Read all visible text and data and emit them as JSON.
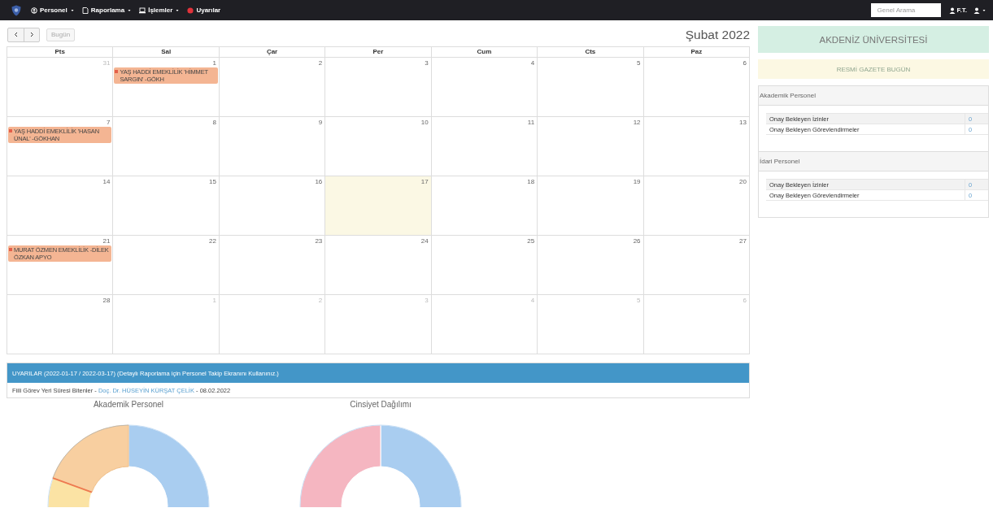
{
  "navbar": {
    "menus": [
      {
        "label": "Personel",
        "kind": "dropdown"
      },
      {
        "label": "Raporlama",
        "kind": "dropdown"
      },
      {
        "label": "İşlemler",
        "kind": "dropdown"
      },
      {
        "label": "Uyarılar",
        "kind": "link"
      }
    ],
    "search": {
      "placeholder": "Genel Arama"
    },
    "user": {
      "label": "F.T."
    }
  },
  "calendar": {
    "title": "Şubat 2022",
    "today_button": {
      "label": "Bugün",
      "disabled": true
    },
    "weekdays": [
      "Pts",
      "Sal",
      "Çar",
      "Per",
      "Cum",
      "Cts",
      "Paz"
    ],
    "weeks": [
      [
        {
          "number": "31",
          "other_month": true,
          "today": false
        },
        {
          "number": "1",
          "other_month": false,
          "today": false,
          "events": [
            {
              "title": "YAŞ HADDİ EMEKLİLİK 'HİMMET SARGIN' -GÖKH",
              "color": "#f4b593"
            }
          ]
        },
        {
          "number": "2",
          "other_month": false,
          "today": false
        },
        {
          "number": "3",
          "other_month": false,
          "today": false
        },
        {
          "number": "4",
          "other_month": false,
          "today": false
        },
        {
          "number": "5",
          "other_month": false,
          "today": false
        },
        {
          "number": "6",
          "other_month": false,
          "today": false
        }
      ],
      [
        {
          "number": "7",
          "other_month": false,
          "today": false,
          "events": [
            {
              "title": "YAŞ HADDİ EMEKLİLİK 'HASAN ÜNAL' -GÖKHAN",
              "color": "#f4b593"
            }
          ]
        },
        {
          "number": "8",
          "other_month": false,
          "today": false
        },
        {
          "number": "9",
          "other_month": false,
          "today": false
        },
        {
          "number": "10",
          "other_month": false,
          "today": false
        },
        {
          "number": "11",
          "other_month": false,
          "today": false
        },
        {
          "number": "12",
          "other_month": false,
          "today": false
        },
        {
          "number": "13",
          "other_month": false,
          "today": false
        }
      ],
      [
        {
          "number": "14",
          "other_month": false,
          "today": false
        },
        {
          "number": "15",
          "other_month": false,
          "today": false
        },
        {
          "number": "16",
          "other_month": false,
          "today": false
        },
        {
          "number": "17",
          "other_month": false,
          "today": true
        },
        {
          "number": "18",
          "other_month": false,
          "today": false
        },
        {
          "number": "19",
          "other_month": false,
          "today": false
        },
        {
          "number": "20",
          "other_month": false,
          "today": false
        }
      ],
      [
        {
          "number": "21",
          "other_month": false,
          "today": false,
          "events": [
            {
              "title": "MURAT ÖZMEN EMEKLİLİK -DİLEK ÖZKAN APYO",
              "color": "#f4b593"
            }
          ]
        },
        {
          "number": "22",
          "other_month": false,
          "today": false
        },
        {
          "number": "23",
          "other_month": false,
          "today": false
        },
        {
          "number": "24",
          "other_month": false,
          "today": false
        },
        {
          "number": "25",
          "other_month": false,
          "today": false
        },
        {
          "number": "26",
          "other_month": false,
          "today": false
        },
        {
          "number": "27",
          "other_month": false,
          "today": false
        }
      ],
      [
        {
          "number": "28",
          "other_month": false,
          "today": false
        },
        {
          "number": "1",
          "other_month": true,
          "today": false
        },
        {
          "number": "2",
          "other_month": true,
          "today": false
        },
        {
          "number": "3",
          "other_month": true,
          "today": false
        },
        {
          "number": "4",
          "other_month": true,
          "today": false
        },
        {
          "number": "5",
          "other_month": true,
          "today": false
        },
        {
          "number": "6",
          "other_month": true,
          "today": false
        }
      ]
    ]
  },
  "alerts": {
    "header": "UYARILAR (2022-01-17 / 2022-03-17) (Detaylı Raporlama için Personel Takip Ekranını Kullanınız.)",
    "items": [
      {
        "label": "Fiili Görev Yeri Süresi Bitenler - ",
        "person": "Doç. Dr. HÜSEYİN KÜRŞAT ÇELİK",
        "date": "- 08.02.2022"
      }
    ]
  },
  "charts": [
    {
      "title": "Akademik Personel",
      "kind": "picture"
    },
    {
      "title": "Cinsiyet Dağılımı",
      "kind": "picture"
    }
  ],
  "sidebar": {
    "university": "AKDENİZ ÜNİVERSİTESİ",
    "gazette": "RESMİ GAZETE BUGÜN",
    "panels": [
      {
        "title": "Akademik Personel",
        "rows": [
          {
            "label": "Onay Bekleyen İzinler",
            "value": "0"
          },
          {
            "label": "Onay Bekleyen Görevlendirmeler",
            "value": "0"
          }
        ]
      },
      {
        "title": "İdari Personel",
        "rows": [
          {
            "label": "Onay Bekleyen İzinler",
            "value": "0"
          },
          {
            "label": "Onay Bekleyen Görevlendirmeler",
            "value": "0"
          }
        ]
      }
    ]
  }
}
